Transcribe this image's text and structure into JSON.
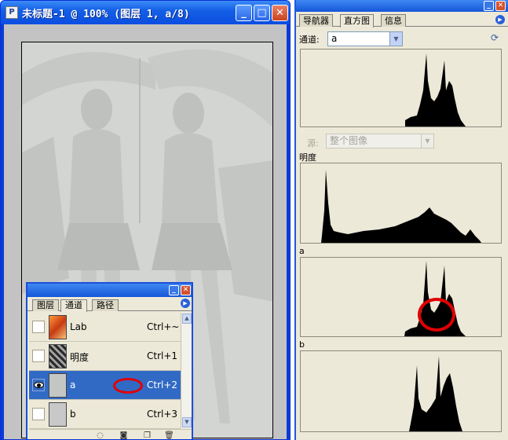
{
  "document": {
    "title": "未标题-1 @ 100% (图层 1, a/8)",
    "app_icon": "ps-document-icon",
    "buttons": {
      "minimize": "_",
      "maximize": "□",
      "close": "✕"
    }
  },
  "channels_panel": {
    "tabs": [
      {
        "label": "图层",
        "active": false
      },
      {
        "label": "通道",
        "active": true
      },
      {
        "label": "路径",
        "active": false
      }
    ],
    "rows": [
      {
        "name": "Lab",
        "shortcut": "Ctrl+~",
        "visible": false,
        "selected": false,
        "thumb": "lab"
      },
      {
        "name": "明度",
        "shortcut": "Ctrl+1",
        "visible": false,
        "selected": false,
        "thumb": "lum"
      },
      {
        "name": "a",
        "shortcut": "Ctrl+2",
        "visible": true,
        "selected": true,
        "thumb": "ach"
      },
      {
        "name": "b",
        "shortcut": "Ctrl+3",
        "visible": false,
        "selected": false,
        "thumb": "bch"
      }
    ],
    "toolbar_icons": [
      "dotted-circle-icon",
      "mask-icon",
      "new-channel-icon",
      "trash-icon"
    ]
  },
  "histogram_panel": {
    "tabs": [
      {
        "label": "导航器",
        "active": false
      },
      {
        "label": "直方图",
        "active": true
      },
      {
        "label": "信息",
        "active": false
      }
    ],
    "channel_label": "通道:",
    "channel_value": "a",
    "source_label": "源:",
    "source_value": "整个图像",
    "sections": {
      "lightness": "明度",
      "a": "a",
      "b": "b"
    }
  },
  "colors": {
    "xp_blue": "#0a3bd7",
    "selection": "#316ac5",
    "annotation_red": "#e00000",
    "panel_bg": "#ece9d8"
  }
}
